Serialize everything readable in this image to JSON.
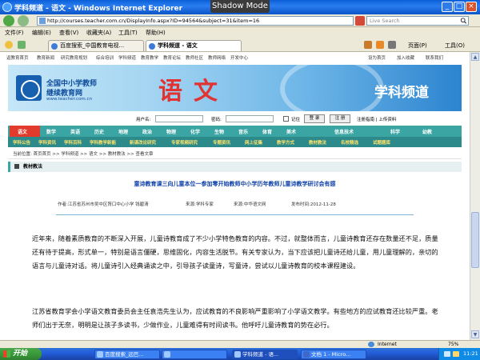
{
  "window": {
    "title": "学科频道 - 语文 - Windows Internet Explorer",
    "overlay_label": "Shadow Mode"
  },
  "address_bar": {
    "url": "http://courses.teacher.com.cn/DisplayInfo.aspx?ID=94564&subject=31&item=16",
    "search_placeholder": "Live Search"
  },
  "menu": [
    "文件(F)",
    "编辑(E)",
    "查看(V)",
    "收藏夹(A)",
    "工具(T)",
    "帮助(H)"
  ],
  "tabs": [
    {
      "label": "百度搜索_中国教育电视...",
      "active": false
    },
    {
      "label": "学科频道 - 语文",
      "active": true
    }
  ],
  "tab_toolbar": {
    "page_label": "页面(P)",
    "tools_label": "工具(O)"
  },
  "page": {
    "top_links": [
      "返教育首页",
      "教育新闻",
      "研究教育规划",
      "综合培训",
      "学科频道",
      "教育教学",
      "教育论坛",
      "教师社区",
      "教师网络",
      "开发中心"
    ],
    "top_links_right": [
      "设为首页",
      "加入收藏",
      "联系我们"
    ],
    "banner": {
      "org_line1": "全国中小学教师",
      "org_line2": "继续教育网",
      "org_url": "www.teacher.com.cn",
      "subject": "语文",
      "channel": "学科频道"
    },
    "login": {
      "username_label": "用户名:",
      "password_label": "密码:",
      "remember_label": "记住",
      "login_button": "登 录",
      "register_button": "注 册",
      "guide_link": "注册指南 | 上传资料"
    },
    "nav_primary": [
      "语文",
      "数学",
      "英语",
      "历史",
      "地理",
      "政治",
      "物理",
      "化学",
      "生物",
      "音乐",
      "体育",
      "美术",
      "信息技术",
      "科学",
      "幼教"
    ],
    "nav_secondary": [
      "学科公告",
      "学科资讯",
      "学科百科",
      "学科教学新能",
      "新课改论研究",
      "专家视频研究",
      "专题资讯",
      "网上征集",
      "教学方式",
      "教材教法",
      "名校精选",
      "试题题库"
    ],
    "breadcrumb": "当前位置: 首页首页 >> 学科频道 >> 语文 >> 教材教法 >> 查看文章",
    "section_heading": "教材教法",
    "article": {
      "title": "童诗教育课三向儿童本位一参加零开始教师中小学历年教师儿童诗教学研讨会有感",
      "author": "作者:江苏省苏州市吴中区胥口中心小学 钱碧清",
      "source": "来源:学科专家",
      "publisher": "来源:中华语文网",
      "date": "发布时间:2012-11-28",
      "para1": "近年来，随着素质教育的不断深入开展，儿童诗教育成了不少小学特色教育的内容。不过，就整体而言，儿童诗教育还存在数量还不足，质量还有待于提高，形式单一，特别是语言僵硬，思维固化，内容生活脱节。有关专家认为，当下应该把儿童诗还给儿童，用儿童理解的，亲切的语言与儿童诗对话。将儿童诗引入经典诵读之中，引导孩子读童诗，写童诗，尝试以儿童诗教育的校本课程建设。",
      "para2": "江苏省教育学会小学语文教育委员会主任袁浩先生认为，应试教育的不良影响严重影响了小学语文教学。有些地方的应试教育还比较严重。老师们出于无奈，明明是让孩子多读书，少做作业，儿童难得有时间读书。他呼吁儿童诗教育的势在必行。"
    }
  },
  "status_bar": {
    "zone": "Internet",
    "zoom": "75%"
  },
  "taskbar": {
    "start_label": "开始",
    "tasks": [
      {
        "label": "百度搜索_远巴...",
        "active": false
      },
      {
        "label": "",
        "active": false
      },
      {
        "label": "学科频道 - 语...",
        "active": true
      },
      {
        "label": "文档 1 - Micro...",
        "active": false
      }
    ],
    "clock": "11:21"
  }
}
